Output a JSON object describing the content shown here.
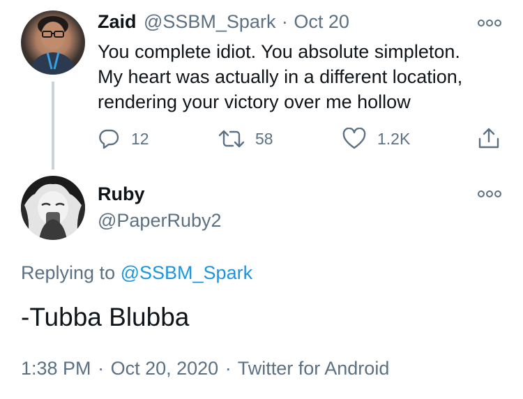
{
  "tweet": {
    "author_name": "Zaid",
    "author_handle": "@SSBM_Spark",
    "separator": "·",
    "date": "Oct 20",
    "text_lines": [
      "You complete idiot. You absolute simpleton.",
      "My heart was actually in a different location,",
      "rendering your victory over me hollow"
    ],
    "actions": {
      "reply_count": "12",
      "retweet_count": "58",
      "like_count": "1.2K"
    },
    "icons": {
      "reply": "reply-icon",
      "retweet": "retweet-icon",
      "like": "heart-icon",
      "share": "share-icon",
      "more": "more-icon"
    }
  },
  "reply": {
    "author_name": "Ruby",
    "author_handle": "@PaperRuby2",
    "replying_prefix": "Replying to",
    "replying_to": "@SSBM_Spark",
    "text": "-Tubba Blubba",
    "timestamp": "1:38 PM",
    "separator": "·",
    "date": "Oct 20, 2020",
    "client": "Twitter for Android"
  },
  "colors": {
    "text": "#0f1419",
    "secondary": "#5b7083",
    "link": "#1b95e0",
    "thread_line": "#c9d3db"
  }
}
